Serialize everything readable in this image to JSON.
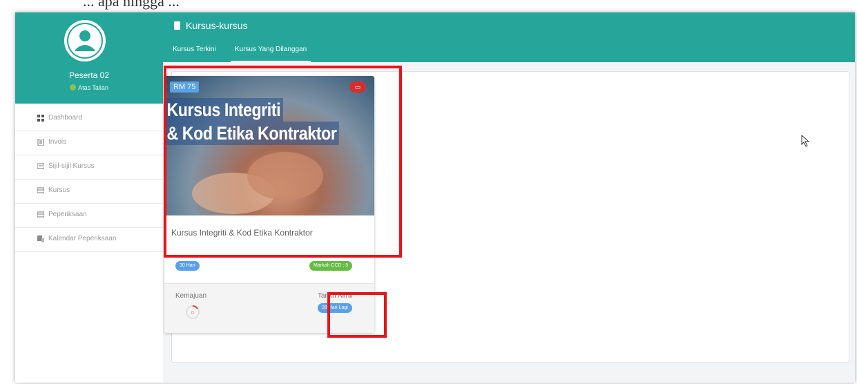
{
  "sidebar": {
    "user_name": "Peserta 02",
    "status": "Atas Talian",
    "items": [
      {
        "label": "Dashboard",
        "icon": "dashboard-icon"
      },
      {
        "label": "Invois",
        "icon": "invoice-icon"
      },
      {
        "label": "Sijil-sijil Kursus",
        "icon": "certificate-icon"
      },
      {
        "label": "Kursus",
        "icon": "course-icon"
      },
      {
        "label": "Peperiksaan",
        "icon": "exam-icon"
      },
      {
        "label": "Kalendar Peperiksaan",
        "icon": "calendar-icon"
      }
    ]
  },
  "header": {
    "title": "Kursus-kursus",
    "tabs": [
      {
        "label": "Kursus Terkini",
        "active": false
      },
      {
        "label": "Kursus Yang Dilanggan",
        "active": true
      }
    ]
  },
  "course_card": {
    "price": "RM 75",
    "banner_line1": "Kursus Integriti",
    "banner_line2": "& Kod Etika Kontraktor",
    "name": "Kursus Integriti & Kod Etika Kontraktor",
    "duration": "30 Hari",
    "cpd": "Markah CCD : 5",
    "progress_label": "Kemajuan",
    "progress_value": "0",
    "deadline_label": "Tarikh Akhir",
    "deadline_value": "28 Hari Lagi"
  },
  "colors": {
    "primary": "#26a69a",
    "highlight": "#e6141b",
    "pill_blue": "#5aa0e6",
    "pill_green": "#66bb44"
  }
}
